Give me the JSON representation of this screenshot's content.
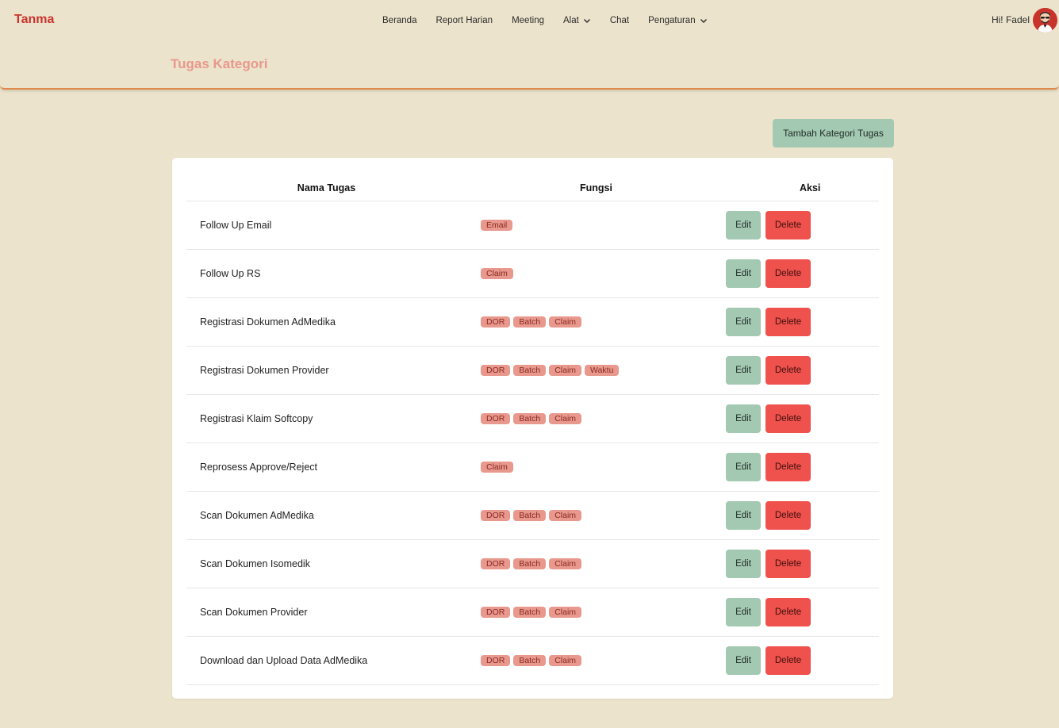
{
  "brand": "Tanma",
  "nav": {
    "items": [
      {
        "label": "Beranda",
        "dropdown": false
      },
      {
        "label": "Report Harian",
        "dropdown": false
      },
      {
        "label": "Meeting",
        "dropdown": false
      },
      {
        "label": "Alat",
        "dropdown": true
      },
      {
        "label": "Chat",
        "dropdown": false
      },
      {
        "label": "Pengaturan",
        "dropdown": true
      }
    ]
  },
  "user": {
    "greeting": "Hi! Fadel"
  },
  "page_title": "Tugas Kategori",
  "add_button": "Tambah Kategori Tugas",
  "table": {
    "headers": [
      "Nama Tugas",
      "Fungsi",
      "Aksi"
    ],
    "edit_label": "Edit",
    "delete_label": "Delete",
    "rows": [
      {
        "name": "Follow Up Email",
        "tags": [
          "Email"
        ]
      },
      {
        "name": "Follow Up RS",
        "tags": [
          "Claim"
        ]
      },
      {
        "name": "Registrasi Dokumen AdMedika",
        "tags": [
          "DOR",
          "Batch",
          "Claim"
        ]
      },
      {
        "name": "Registrasi Dokumen Provider",
        "tags": [
          "DOR",
          "Batch",
          "Claim",
          "Waktu"
        ]
      },
      {
        "name": "Registrasi Klaim Softcopy",
        "tags": [
          "DOR",
          "Batch",
          "Claim"
        ]
      },
      {
        "name": "Reprosess Approve/Reject",
        "tags": [
          "Claim"
        ]
      },
      {
        "name": "Scan Dokumen AdMedika",
        "tags": [
          "DOR",
          "Batch",
          "Claim"
        ]
      },
      {
        "name": "Scan Dokumen Isomedik",
        "tags": [
          "DOR",
          "Batch",
          "Claim"
        ]
      },
      {
        "name": "Scan Dokumen Provider",
        "tags": [
          "DOR",
          "Batch",
          "Claim"
        ]
      },
      {
        "name": "Download dan Upload Data AdMedika",
        "tags": [
          "DOR",
          "Batch",
          "Claim"
        ]
      }
    ]
  },
  "colors": {
    "brand": "#c8342c",
    "title": "#e8988c",
    "green": "#a3c9b2",
    "red": "#ef514c",
    "background": "#ece3cc"
  }
}
